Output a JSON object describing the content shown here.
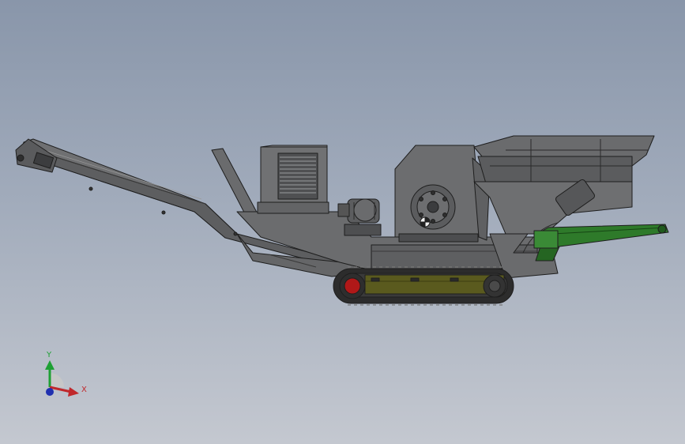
{
  "viewport": {
    "model": "mobile-crusher-tracked-assembly",
    "colors": {
      "background_top": "#8996aa",
      "background_bottom": "#c4c8d0",
      "body": "#6f7072",
      "body_dark": "#4a4b4d",
      "edge": "#1e1e1e",
      "track": "#2c2c2c",
      "track_frame": "#5a5a1e",
      "drive_wheel": "#b01818",
      "side_conveyor": "#2e7a2a"
    }
  },
  "triad": {
    "x_label": "X",
    "y_label": "Y",
    "x_color": "#c0282c",
    "y_color": "#1ea034",
    "z_color": "#2030b0"
  }
}
